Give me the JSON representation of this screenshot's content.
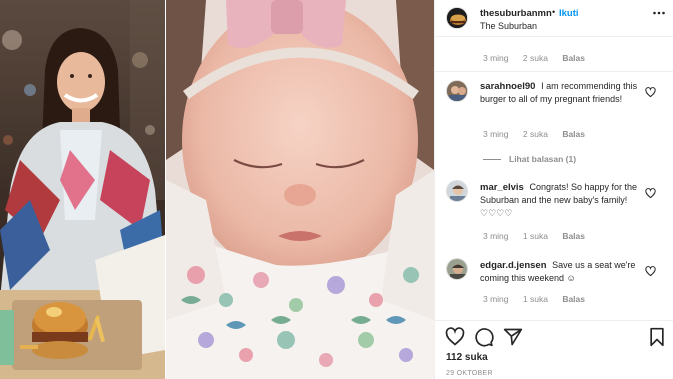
{
  "post": {
    "username": "thesuburbanmn",
    "dot": "•",
    "follow_label": "Ikuti",
    "location": "The Suburban",
    "more_icon": "more-horizontal-icon"
  },
  "caption_meta": {
    "time": "3 ming",
    "likes": "2 suka",
    "reply": "Balas"
  },
  "comments": [
    {
      "username": "sarahnoel90",
      "text": "I am recommending this burger to all of my pregnant friends!",
      "time": "3 ming",
      "likes": "2 suka",
      "reply": "Balas",
      "view_replies": "Lihat balasan (1)"
    },
    {
      "username": "mar_elvis",
      "text": "Congrats! So happy for the Suburban and the new baby's family!♡♡♡♡",
      "time": "3 ming",
      "likes": "1 suka",
      "reply": "Balas"
    },
    {
      "username": "edgar.d.jensen",
      "text": "Save us a seat we're coming this weekend ☺",
      "time": "3 ming",
      "likes": "1 suka",
      "reply": "Balas"
    }
  ],
  "actions": {
    "like_icon": "heart-icon",
    "comment_icon": "comment-icon",
    "share_icon": "paper-plane-icon",
    "save_icon": "bookmark-icon"
  },
  "likes_count": "112 suka",
  "date": "29 OKTOBER"
}
